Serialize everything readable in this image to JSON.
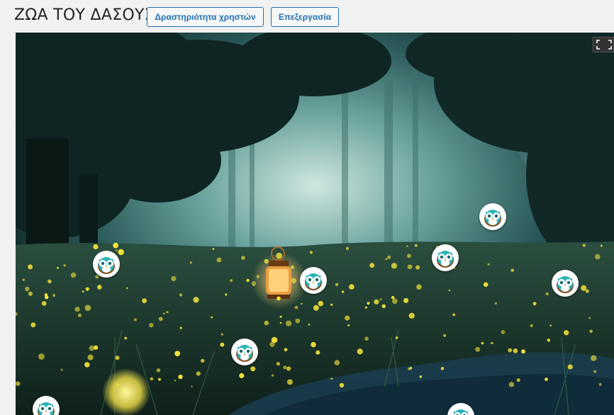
{
  "header": {
    "title": "ΖΩΑ ΤΟΥ ΔΑΣΟΥΣ",
    "activity_button": "Δραστηριότητα χρηστών",
    "edit_button": "Επεξεργασία"
  },
  "stage": {
    "background": "forest-with-fireflies-image",
    "fullscreen_icon": "fullscreen-icon",
    "hotspot_icon": "owl-icon",
    "hotspot_count": 10
  },
  "colors": {
    "button_accent": "#2271b1",
    "owl_teal": "#2bb3b8",
    "owl_brown": "#8a4a1a"
  }
}
